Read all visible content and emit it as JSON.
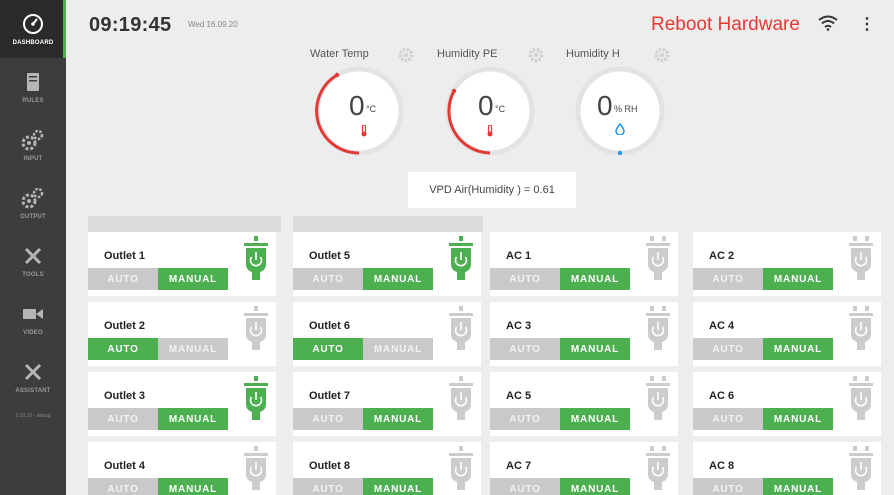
{
  "sidebar": {
    "items": [
      {
        "label": "DASHBOARD",
        "icon": "speedometer-icon",
        "active": true
      },
      {
        "label": "RULES",
        "icon": "book-icon",
        "active": false
      },
      {
        "label": "INPUT",
        "icon": "gears-icon",
        "active": false
      },
      {
        "label": "OUTPUT",
        "icon": "gears-icon",
        "active": false
      },
      {
        "label": "TOOLS",
        "icon": "tools-icon",
        "active": false
      },
      {
        "label": "VIDEO",
        "icon": "video-camera-icon",
        "active": false
      },
      {
        "label": "ASSISTANT",
        "icon": "tools-icon",
        "active": false
      }
    ],
    "version": "2.10.10 - debug"
  },
  "header": {
    "time": "09:19:45",
    "date": "Wed 16.09.20",
    "reboot_label": "Reboot Hardware"
  },
  "gauges": [
    {
      "title": "Water Temp",
      "value": "0",
      "unit": "°C",
      "icon": "thermometer-icon",
      "color": "#e53935"
    },
    {
      "title": "Humidity PE",
      "value": "0",
      "unit": "°C",
      "icon": "thermometer-icon",
      "color": "#e53935"
    },
    {
      "title": "Humidity H",
      "value": "0",
      "unit": "% RH",
      "icon": "water-drop-icon",
      "color": "#2196f3"
    }
  ],
  "vpd": {
    "text": "VPD Air(Humidity ) = 0.61"
  },
  "buttons": {
    "auto": "AUTO",
    "manual": "MANUAL"
  },
  "outlets": [
    {
      "name": "Outlet 1",
      "mode": "manual",
      "plug_on": true
    },
    {
      "name": "Outlet 2",
      "mode": "auto",
      "plug_on": false
    },
    {
      "name": "Outlet 3",
      "mode": "manual",
      "plug_on": true
    },
    {
      "name": "Outlet 4",
      "mode": "manual",
      "plug_on": false
    },
    {
      "name": "Outlet 5",
      "mode": "manual",
      "plug_on": true
    },
    {
      "name": "Outlet 6",
      "mode": "auto",
      "plug_on": false
    },
    {
      "name": "Outlet 7",
      "mode": "manual",
      "plug_on": false
    },
    {
      "name": "Outlet 8",
      "mode": "manual",
      "plug_on": false
    },
    {
      "name": "AC 1",
      "mode": "manual",
      "plug_on": false
    },
    {
      "name": "AC 3",
      "mode": "manual",
      "plug_on": false
    },
    {
      "name": "AC 5",
      "mode": "manual",
      "plug_on": false
    },
    {
      "name": "AC 7",
      "mode": "manual",
      "plug_on": false
    },
    {
      "name": "AC 2",
      "mode": "manual",
      "plug_on": false
    },
    {
      "name": "AC 4",
      "mode": "manual",
      "plug_on": false
    },
    {
      "name": "AC 6",
      "mode": "manual",
      "plug_on": false
    },
    {
      "name": "AC 8",
      "mode": "manual",
      "plug_on": false
    }
  ],
  "colors": {
    "accent": "#4caf50",
    "danger": "#e53935",
    "info": "#2196f3",
    "sidebar": "#3d3d3d"
  }
}
